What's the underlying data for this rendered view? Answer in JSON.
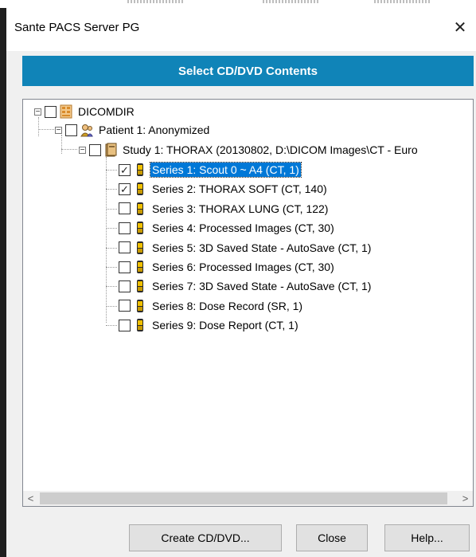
{
  "window": {
    "title": "Sante PACS Server PG",
    "close_glyph": "✕"
  },
  "banner": {
    "label": "Select CD/DVD Contents",
    "color": "#1084b8"
  },
  "tree": {
    "root": {
      "label": "DICOMDIR",
      "icon": "dicomdir-icon",
      "checked": false,
      "expanded": true
    },
    "patient": {
      "label": "Patient 1: Anonymized",
      "icon": "patient-icon",
      "checked": false,
      "expanded": true
    },
    "study": {
      "label": "Study 1: THORAX (20130802, D:\\DICOM Images\\CT - Euro",
      "icon": "study-icon",
      "checked": false,
      "expanded": true
    },
    "series": [
      {
        "label": "Series 1: Scout  0 ~ A4 (CT, 1)",
        "checked": true,
        "selected": true
      },
      {
        "label": "Series 2: THORAX SOFT (CT, 140)",
        "checked": true,
        "selected": false
      },
      {
        "label": "Series 3: THORAX LUNG (CT, 122)",
        "checked": false,
        "selected": false
      },
      {
        "label": "Series 4: Processed Images (CT, 30)",
        "checked": false,
        "selected": false
      },
      {
        "label": "Series 5: 3D Saved State - AutoSave (CT, 1)",
        "checked": false,
        "selected": false
      },
      {
        "label": "Series 6: Processed Images (CT, 30)",
        "checked": false,
        "selected": false
      },
      {
        "label": "Series 7: 3D Saved State - AutoSave (CT, 1)",
        "checked": false,
        "selected": false
      },
      {
        "label": "Series 8: Dose Record (SR, 1)",
        "checked": false,
        "selected": false
      },
      {
        "label": "Series 9: Dose Report (CT, 1)",
        "checked": false,
        "selected": false
      }
    ]
  },
  "scrollbar": {
    "left_arrow": "<",
    "right_arrow": ">"
  },
  "buttons": {
    "create": "Create CD/DVD...",
    "close": "Close",
    "help": "Help..."
  }
}
